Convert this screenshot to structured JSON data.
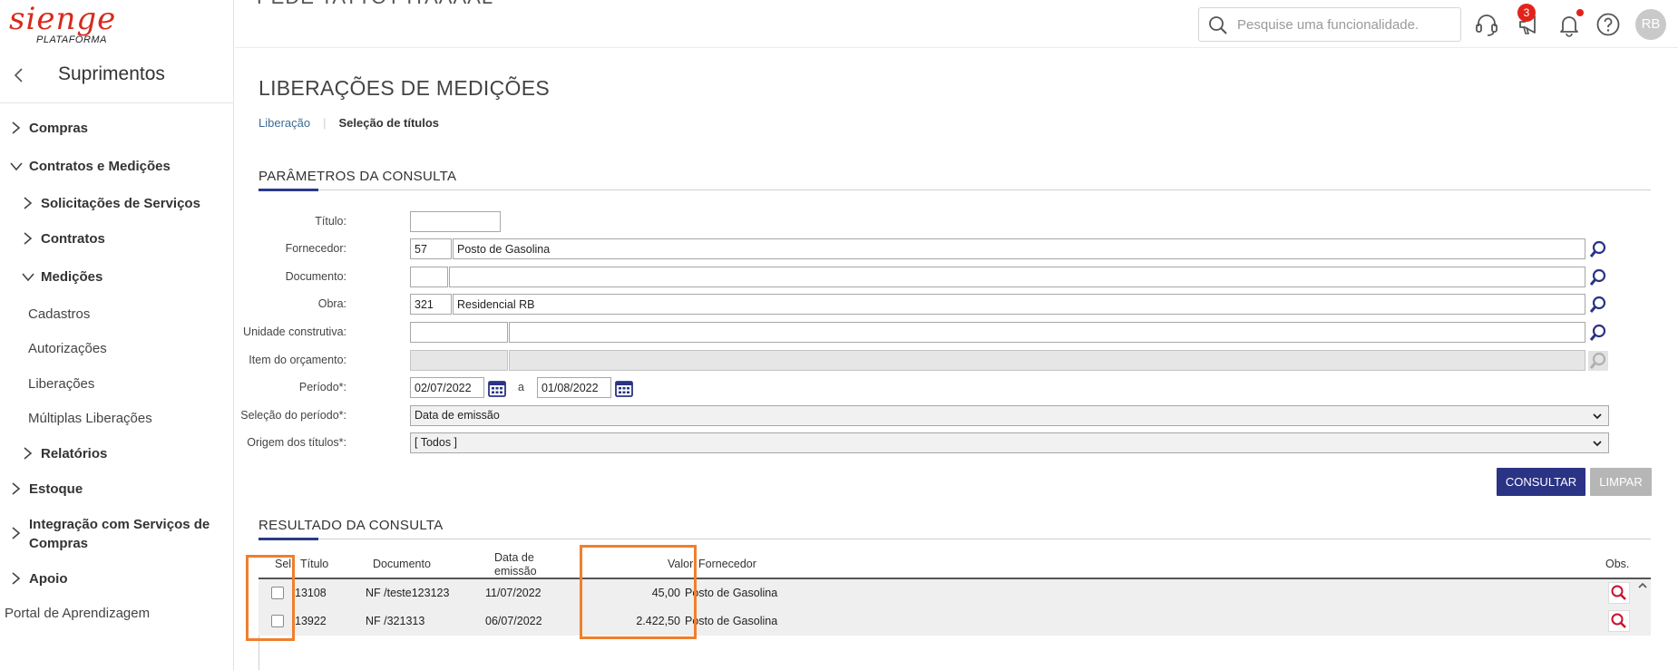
{
  "brand": {
    "logo_text": "sienge",
    "logo_sub": "PLATAFORMA"
  },
  "topbar": {
    "search_placeholder": "Pesquise uma funcionalidade.",
    "notifications_count": "3",
    "avatar_initials": "RB",
    "partial_heading": "PEDE TATTOT ITAAAAL"
  },
  "sidebar": {
    "title": "Suprimentos",
    "items": [
      {
        "label": "Compras"
      },
      {
        "label": "Contratos e Medições"
      },
      {
        "label": "Solicitações de Serviços"
      },
      {
        "label": "Contratos"
      },
      {
        "label": "Medições"
      },
      {
        "label": "Cadastros"
      },
      {
        "label": "Autorizações"
      },
      {
        "label": "Liberações"
      },
      {
        "label": "Múltiplas Liberações"
      },
      {
        "label": "Relatórios"
      },
      {
        "label": "Estoque"
      },
      {
        "label": "Integração com Serviços de Compras"
      },
      {
        "label": "Apoio"
      },
      {
        "label": "Portal de Aprendizagem"
      }
    ]
  },
  "page": {
    "title": "LIBERAÇÕES DE MEDIÇÕES",
    "breadcrumb": {
      "step1": "Liberação",
      "step2": "Seleção de títulos"
    }
  },
  "params": {
    "section_title": "PARÂMETROS DA CONSULTA",
    "titulo_label": "Título:",
    "titulo_value": "",
    "fornecedor_label": "Fornecedor:",
    "fornecedor_code": "57",
    "fornecedor_name": "Posto de Gasolina",
    "documento_label": "Documento:",
    "documento_code": "",
    "documento_name": "",
    "obra_label": "Obra:",
    "obra_code": "321",
    "obra_name": "Residencial RB",
    "unidade_label": "Unidade construtiva:",
    "item_label": "Item do orçamento:",
    "periodo_label": "Período*:",
    "periodo_de": "02/07/2022",
    "periodo_sep": "a",
    "periodo_ate": "01/08/2022",
    "selecao_label": "Seleção do período*:",
    "selecao_value": "Data de emissão",
    "origem_label": "Origem dos títulos*:",
    "origem_value": "[ Todos ]",
    "btn_consultar": "CONSULTAR",
    "btn_limpar": "LIMPAR"
  },
  "result": {
    "section_title": "RESULTADO DA CONSULTA",
    "columns": {
      "sel": "Sel.",
      "titulo": "Título",
      "documento": "Documento",
      "data_l1": "Data de",
      "data_l2": "emissão",
      "valor": "Valor",
      "fornecedor": "Fornecedor",
      "obs": "Obs."
    },
    "rows": [
      {
        "titulo": "13108",
        "documento": "NF /teste123123",
        "data": "11/07/2022",
        "valor": "45,00",
        "fornecedor": "Posto de Gasolina",
        "selected": false
      },
      {
        "titulo": "13922",
        "documento": "NF /321313",
        "data": "06/07/2022",
        "valor": "2.422,50",
        "fornecedor": "Posto de Gasolina",
        "selected": false
      }
    ]
  },
  "colors": {
    "accent": "#2a3384",
    "highlight": "#f07f2c",
    "brand": "#d72a1e",
    "badge": "#e2231a"
  }
}
